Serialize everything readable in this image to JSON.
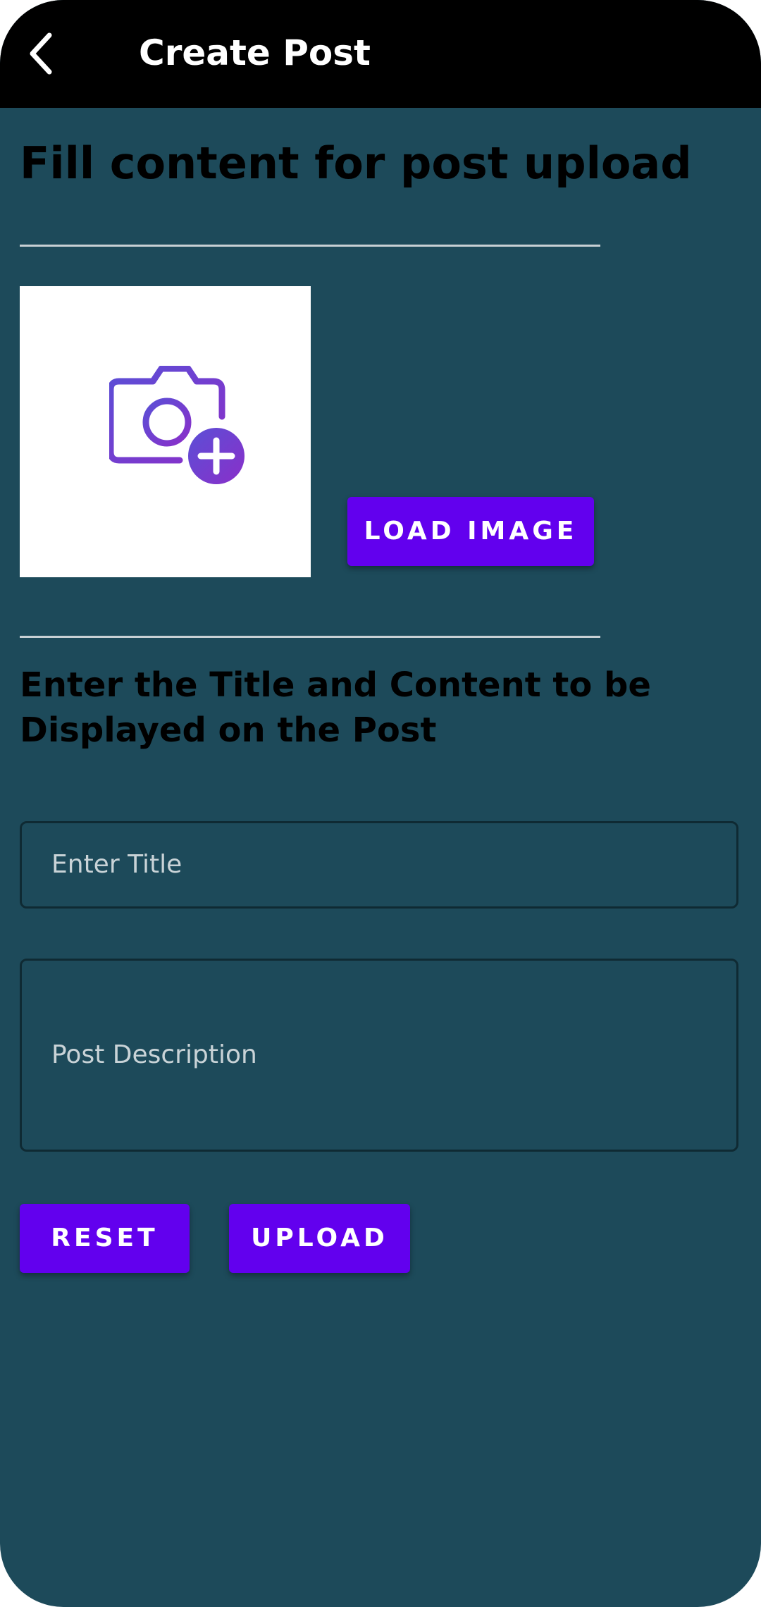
{
  "toolbar": {
    "back_icon": "arrow-back-icon",
    "title": "Create Post"
  },
  "main": {
    "heading": "Fill content for post upload",
    "image_placeholder_icon": "add-photo-camera-icon",
    "load_image_label": "LOAD IMAGE",
    "subheading_line1": "Enter the Title and Content to be",
    "subheading_line2": "Displayed on the Post",
    "title_field": {
      "value": "",
      "placeholder": "Enter Title"
    },
    "description_field": {
      "value": "",
      "placeholder": "Post Description"
    },
    "reset_label": "RESET",
    "upload_label": "UPLOAD"
  },
  "colors": {
    "background": "#1d4a5a",
    "toolbar": "#000000",
    "button": "#6200ee",
    "icon_gradient_start": "#5b4fd6",
    "icon_gradient_end": "#8a2fc9"
  }
}
